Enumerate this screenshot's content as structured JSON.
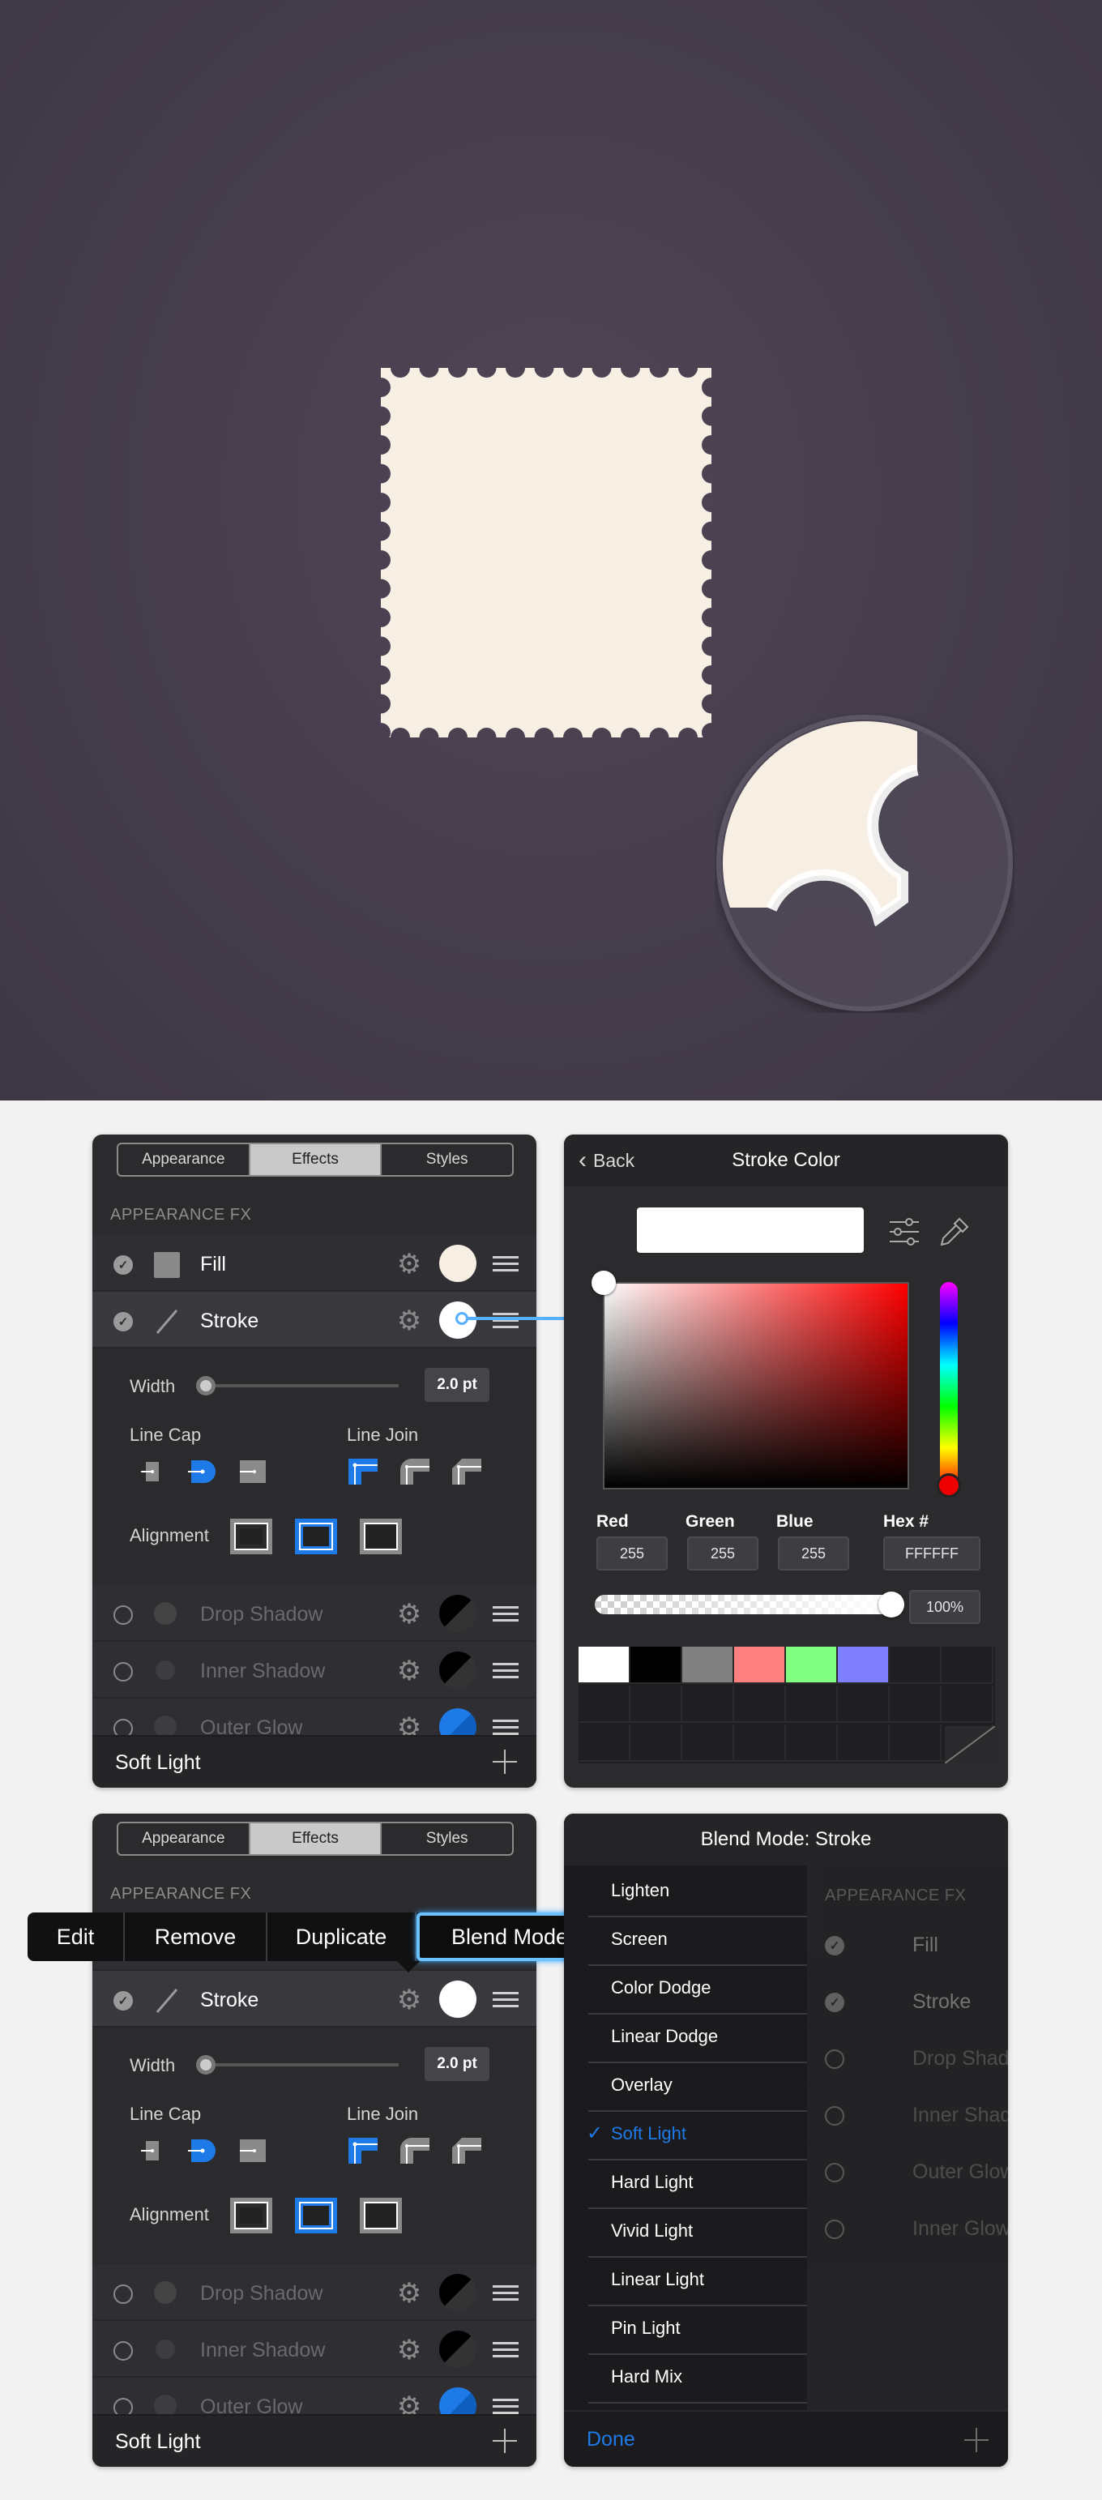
{
  "colors": {
    "accent": "#1e7ae6",
    "stamp": "#f7eee4",
    "hero_bg": "#463e4d",
    "panel_bg": "#2b2b2e"
  },
  "effects_panel": {
    "tabs": [
      "Appearance",
      "Effects",
      "Styles"
    ],
    "selected_tab": "Effects",
    "section_header": "APPEARANCE FX",
    "rows": [
      {
        "label": "Fill",
        "checked": true,
        "swatch": "#f7eee4",
        "icon": "square-icon"
      },
      {
        "label": "Stroke",
        "checked": true,
        "swatch": "#ffffff",
        "icon": "line-icon"
      },
      {
        "label": "Drop Shadow",
        "checked": false,
        "swatch": "black-gradient"
      },
      {
        "label": "Inner Shadow",
        "checked": false,
        "swatch": "black-gradient"
      },
      {
        "label": "Outer Glow",
        "checked": false,
        "swatch": "blue-gradient"
      }
    ],
    "width_label": "Width",
    "width_value": "2.0 pt",
    "width_fraction": 0.05,
    "line_cap_label": "Line Cap",
    "line_join_label": "Line Join",
    "alignment_label": "Alignment",
    "footer_blend": "Soft Light"
  },
  "color_panel": {
    "back_label": "Back",
    "title": "Stroke Color",
    "red_label": "Red",
    "green_label": "Green",
    "blue_label": "Blue",
    "hex_label": "Hex #",
    "red_value": "255",
    "green_value": "255",
    "blue_value": "255",
    "hex_value": "FFFFFF",
    "opacity_value": "100%",
    "opacity_fraction": 1.0,
    "swatches": [
      "#ffffff",
      "#000000",
      "#808080",
      "#ff8080",
      "#80ff80",
      "#8080ff"
    ]
  },
  "context_menu": {
    "edit": "Edit",
    "remove": "Remove",
    "duplicate": "Duplicate",
    "blend_mode": "Blend Mode"
  },
  "blend_panel": {
    "title": "Blend Mode: Stroke",
    "modes": [
      "Lighten",
      "Screen",
      "Color Dodge",
      "Linear Dodge",
      "Overlay",
      "Soft Light",
      "Hard Light",
      "Vivid Light",
      "Linear Light",
      "Pin Light",
      "Hard Mix"
    ],
    "selected_mode": "Soft Light",
    "done_label": "Done",
    "behind_header": "APPEARANCE FX",
    "behind_rows": [
      "Fill",
      "Stroke",
      "Drop Shadow",
      "Inner Shadow",
      "Outer Glow",
      "Inner Glow"
    ]
  }
}
